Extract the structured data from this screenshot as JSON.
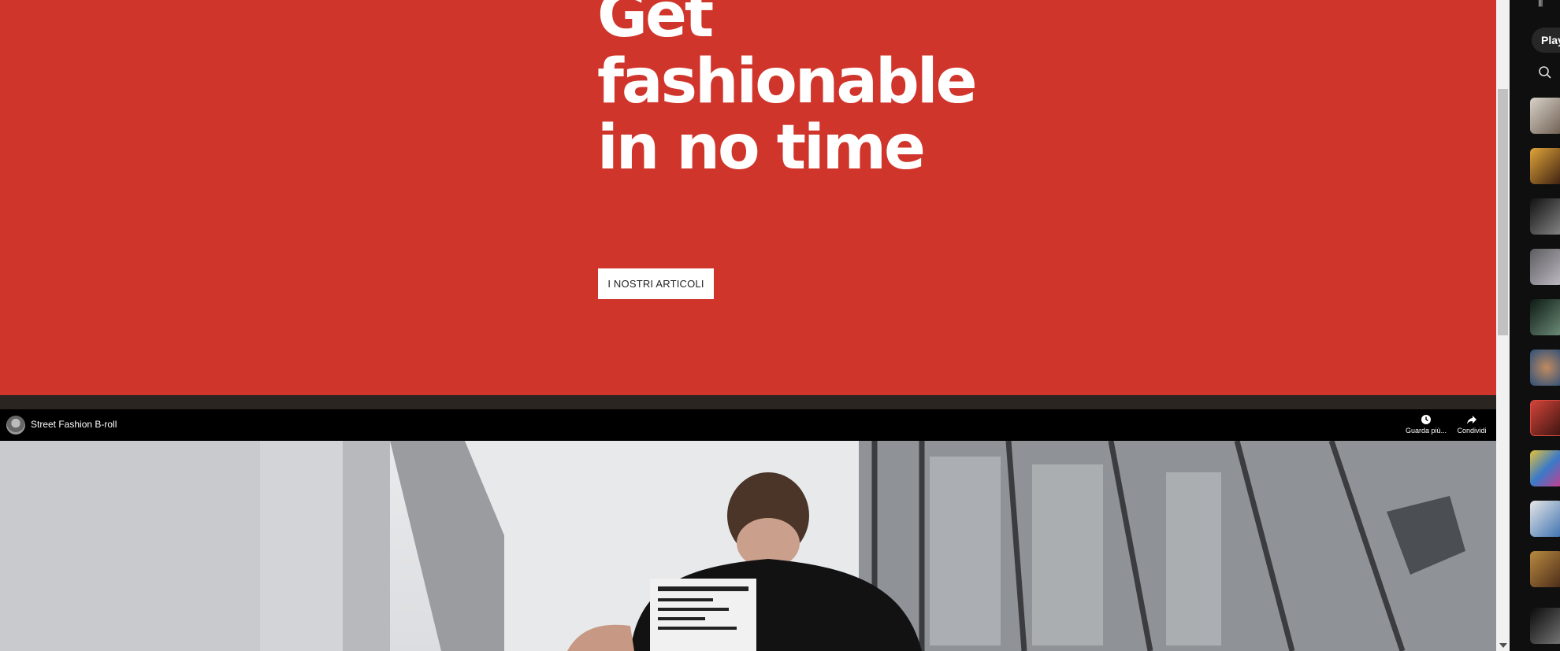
{
  "hero": {
    "title": "Get fashionable in no time",
    "button_label": "I NOSTRI ARTICOLI",
    "background": "#d0352b"
  },
  "video": {
    "title": "Street Fashion B-roll",
    "watch_later_label": "Guarda più...",
    "share_label": "Condividi"
  },
  "sidebar": {
    "play_label": "Play",
    "top_glyph": "⫼"
  }
}
